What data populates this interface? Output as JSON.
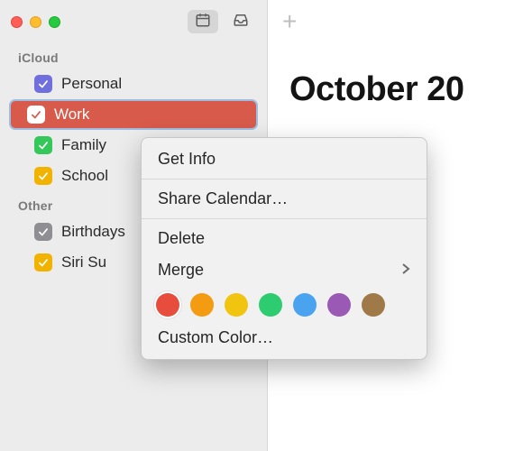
{
  "sidebar": {
    "sections": [
      {
        "title": "iCloud",
        "items": [
          {
            "label": "Personal",
            "color": "#6f6fde",
            "checked": true,
            "selected": false
          },
          {
            "label": "Work",
            "color": "#ffffff",
            "bg": "#d75a4a",
            "checked": true,
            "selected": true
          },
          {
            "label": "Family",
            "color": "#34c759",
            "checked": true,
            "selected": false
          },
          {
            "label": "School",
            "color": "#f2b200",
            "checked": true,
            "selected": false
          }
        ]
      },
      {
        "title": "Other",
        "items": [
          {
            "label": "Birthdays",
            "color": "#8e8e93",
            "checked": true,
            "selected": false
          },
          {
            "label": "Siri Suggestions",
            "display": "Siri Su",
            "color": "#f2b200",
            "checked": true,
            "selected": false
          }
        ]
      }
    ]
  },
  "main": {
    "title": "October 20"
  },
  "context_menu": {
    "items": [
      {
        "label": "Get Info",
        "type": "item"
      },
      {
        "type": "sep"
      },
      {
        "label": "Share Calendar…",
        "type": "item"
      },
      {
        "type": "sep"
      },
      {
        "label": "Delete",
        "type": "item"
      },
      {
        "label": "Merge",
        "type": "submenu"
      },
      {
        "type": "swatches"
      },
      {
        "label": "Custom Color…",
        "type": "item"
      }
    ],
    "colors": [
      {
        "hex": "#e74c3c",
        "name": "red",
        "selected": true
      },
      {
        "hex": "#f39c12",
        "name": "orange"
      },
      {
        "hex": "#f1c40f",
        "name": "yellow"
      },
      {
        "hex": "#2ecc71",
        "name": "green"
      },
      {
        "hex": "#4aa3ef",
        "name": "blue"
      },
      {
        "hex": "#9b59b6",
        "name": "purple"
      },
      {
        "hex": "#a07948",
        "name": "brown"
      }
    ]
  }
}
